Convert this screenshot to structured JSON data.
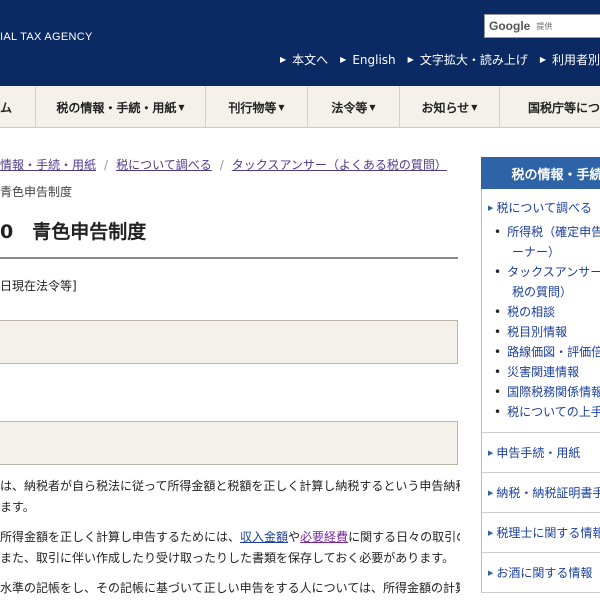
{
  "header": {
    "agency_name": "IAL TAX AGENCY",
    "search_brand": "Google",
    "search_sub": "提供",
    "utility": [
      "本文へ",
      "English",
      "文字拡大・読み上げ",
      "利用者別に"
    ]
  },
  "global_nav": [
    "ム",
    "税の情報・手続・用紙",
    "刊行物等",
    "法令等",
    "お知らせ",
    "国税庁等につい"
  ],
  "breadcrumb": {
    "links": [
      "情報・手続・用紙",
      "税について調べる",
      "タックスアンサー（よくある税の質問）"
    ],
    "current": "青色申告制度"
  },
  "main": {
    "title": "0　青色申告制度",
    "law_date": "日現在法令等]",
    "paragraphs": [
      {
        "lines": [
          [
            {
              "t": "は、納税者が自ら税法に従って所得金額と税額を正しく計算し納税するという申告納税"
            }
          ],
          [
            {
              "t": "ます。"
            }
          ]
        ]
      },
      {
        "lines": [
          [
            {
              "t": "所得金額を正しく計算し申告するためには、"
            },
            {
              "t": "収入金額",
              "link": "blue"
            },
            {
              "t": "や"
            },
            {
              "t": "必要経費",
              "link": "purple"
            },
            {
              "t": "に関する日々の取引の"
            }
          ],
          [
            {
              "t": "また、取引に伴い作成したり受け取ったりした書類を保存しておく必要があります。"
            }
          ]
        ]
      },
      {
        "lines": [
          [
            {
              "t": "水準の記帳をし、その記帳に基づいて正しい申告をする人については、所得金額の計算"
            }
          ]
        ]
      }
    ]
  },
  "sidenav": {
    "heading": "税の情報・手続",
    "top_link": "税について調べる",
    "sub_items": [
      [
        "所得税（確定申告",
        "ーナー）"
      ],
      [
        "タックスアンサー",
        "税の質問）"
      ],
      [
        "税の相談"
      ],
      [
        "税目別情報"
      ],
      [
        "路線価図・評価倍"
      ],
      [
        "災害関連情報"
      ],
      [
        "国際税務関係情報"
      ],
      [
        "税についての上手"
      ]
    ],
    "sections": [
      "申告手続・用紙",
      "納税・納税証明書手",
      "税理士に関する情報",
      "お酒に関する情報"
    ]
  }
}
